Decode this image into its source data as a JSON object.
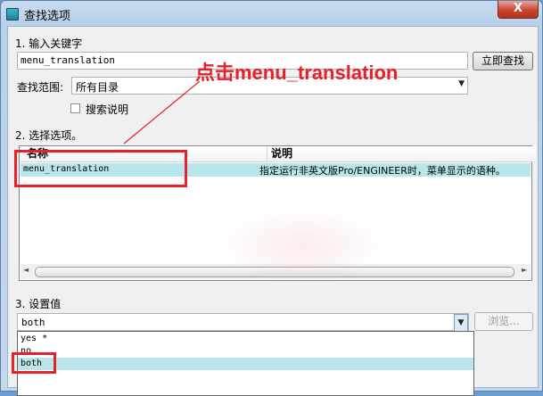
{
  "window": {
    "title": "查找选项",
    "close_label": "X"
  },
  "section1": {
    "label": "1.  输入关键字",
    "keyword_value": "menu_translation",
    "search_button": "立即查找"
  },
  "scope": {
    "label": "查找范围:",
    "selected": "所有目录",
    "search_desc_label": "搜索说明"
  },
  "section2": {
    "label": "2.  选择选项。",
    "columns": [
      "名称",
      "说明"
    ],
    "rows": [
      {
        "name": "menu_translation",
        "desc": "指定运行非英文版Pro/ENGINEER时，菜单显示的语种。"
      }
    ]
  },
  "section3": {
    "label": "3.  设置值",
    "value": "both",
    "browse_button": "浏览...",
    "options": [
      "yes *",
      "no",
      "both"
    ],
    "selected_option": "both"
  },
  "annotation": {
    "text": "点击menu_translation",
    "color": "#e8202a"
  }
}
